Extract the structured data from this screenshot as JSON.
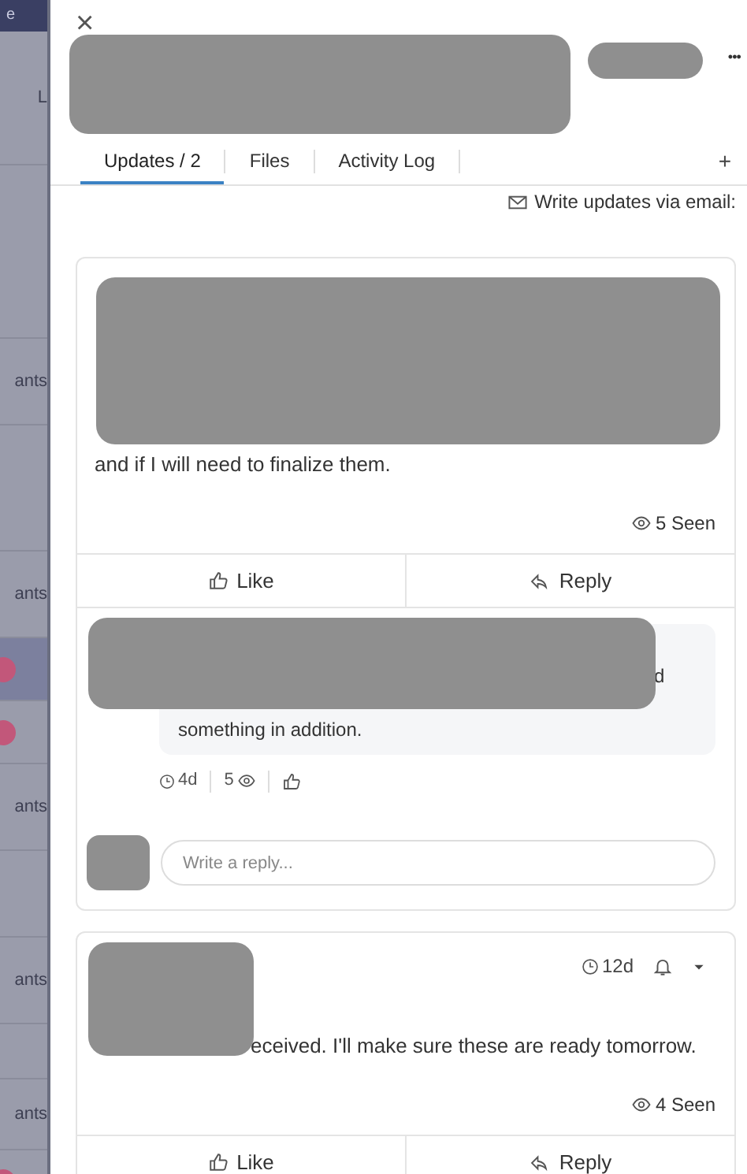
{
  "board": {
    "top_label": "e",
    "rows": [
      {
        "kind": "label",
        "text": "L"
      },
      {
        "kind": "divider"
      },
      {
        "kind": "label",
        "text": "ants"
      },
      {
        "kind": "divider"
      },
      {
        "kind": "label",
        "text": "ants"
      },
      {
        "kind": "avatar",
        "highlighted": true
      },
      {
        "kind": "avatar",
        "highlighted": false
      },
      {
        "kind": "label",
        "text": "ants"
      },
      {
        "kind": "divider"
      },
      {
        "kind": "label",
        "text": "ants"
      },
      {
        "kind": "divider"
      },
      {
        "kind": "label",
        "text": "ants"
      },
      {
        "kind": "avatar",
        "highlighted": false
      }
    ]
  },
  "panel": {
    "close": "×",
    "more": "•••",
    "tabs": [
      {
        "label": "Updates / 2",
        "selected": true
      },
      {
        "label": "Files",
        "selected": false
      },
      {
        "label": "Activity Log",
        "selected": false
      }
    ],
    "add_tab": "+",
    "email_link": "Write updates via email:",
    "updates": [
      {
        "body": "and if I will need to finalize them.",
        "seen": "5 Seen",
        "like": "Like",
        "reply": "Reply",
        "replies": [
          {
            "fragment": "d",
            "body": "something in addition.",
            "time": "4d",
            "seen": "5"
          }
        ],
        "reply_placeholder": "Write a reply..."
      },
      {
        "time": "12d",
        "body": "eceived. I'll make sure these are ready tomorrow.",
        "seen": "4 Seen",
        "like": "Like",
        "reply": "Reply"
      }
    ]
  }
}
